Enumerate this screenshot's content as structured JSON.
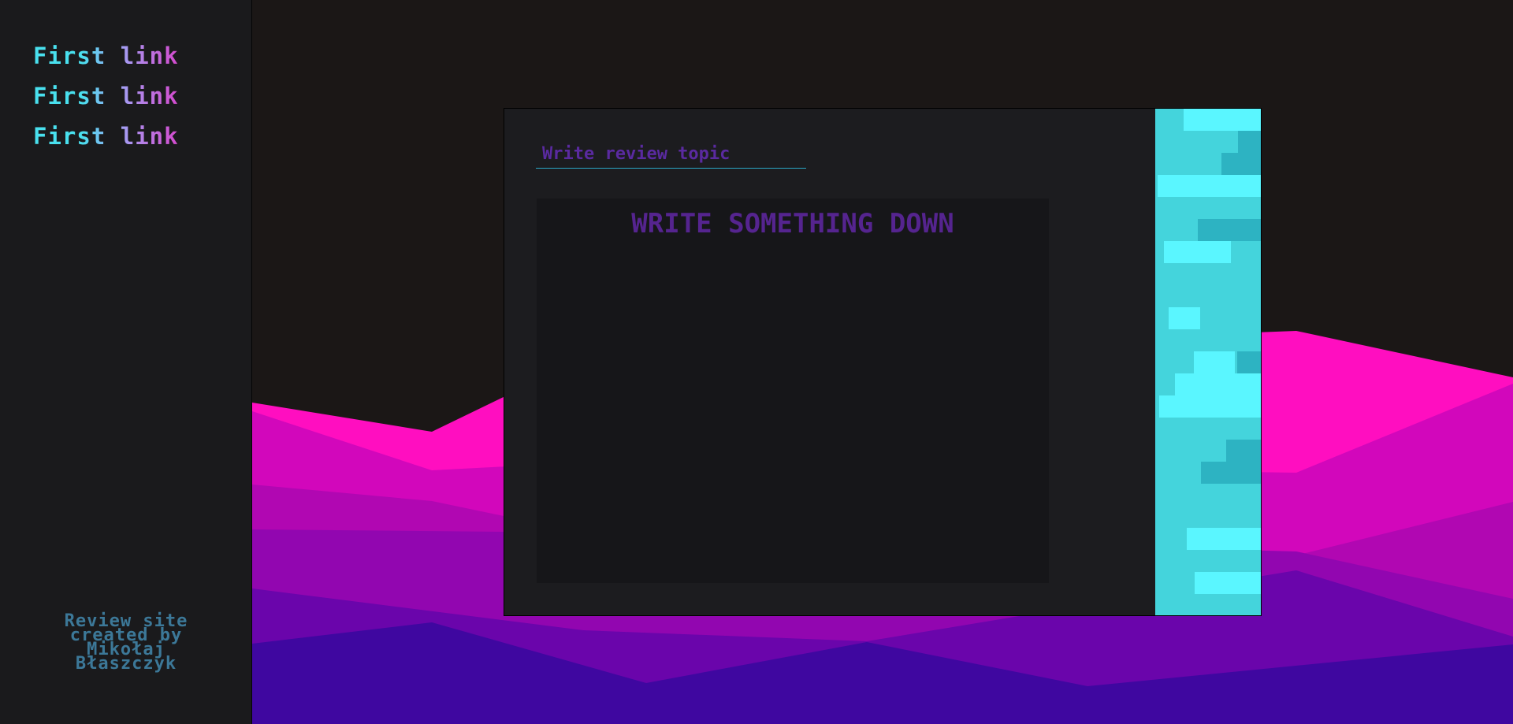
{
  "nav": {
    "links": [
      "First link",
      "First link",
      "First link"
    ]
  },
  "footer": {
    "credit_lines": [
      "Review site",
      "created by",
      "Mikołaj",
      "Błaszczyk"
    ]
  },
  "editor": {
    "topic_placeholder": "Write review topic",
    "body_placeholder": "WRITE SOMETHING DOWN"
  },
  "colors": {
    "background": "#1b1716",
    "sidebar": "#1a1a1c",
    "accent_cyan": "#49e0ee",
    "accent_purple": "#5a2aa0",
    "mountain_pink": "#ff0ec0",
    "mountain_indigo": "#3f07a0"
  }
}
